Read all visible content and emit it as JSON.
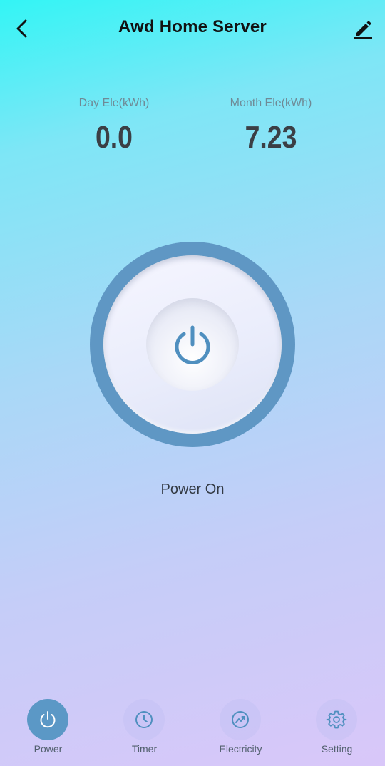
{
  "header": {
    "title": "Awd Home Server"
  },
  "stats": {
    "day": {
      "label": "Day Ele(kWh)",
      "value": "0.0"
    },
    "month": {
      "label": "Month Ele(kWh)",
      "value": "7.23"
    }
  },
  "power": {
    "status": "Power On",
    "state": "on",
    "ring_color": "#5f97c4"
  },
  "tabs": [
    {
      "label": "Power",
      "icon": "power-icon",
      "active": true
    },
    {
      "label": "Timer",
      "icon": "clock-icon",
      "active": false
    },
    {
      "label": "Electricity",
      "icon": "trend-chart-icon",
      "active": false
    },
    {
      "label": "Setting",
      "icon": "gear-icon",
      "active": false
    }
  ],
  "colors": {
    "accent": "#5b98c6",
    "gradient_top": "#33f5f5",
    "gradient_bottom": "#d9c7f9"
  }
}
